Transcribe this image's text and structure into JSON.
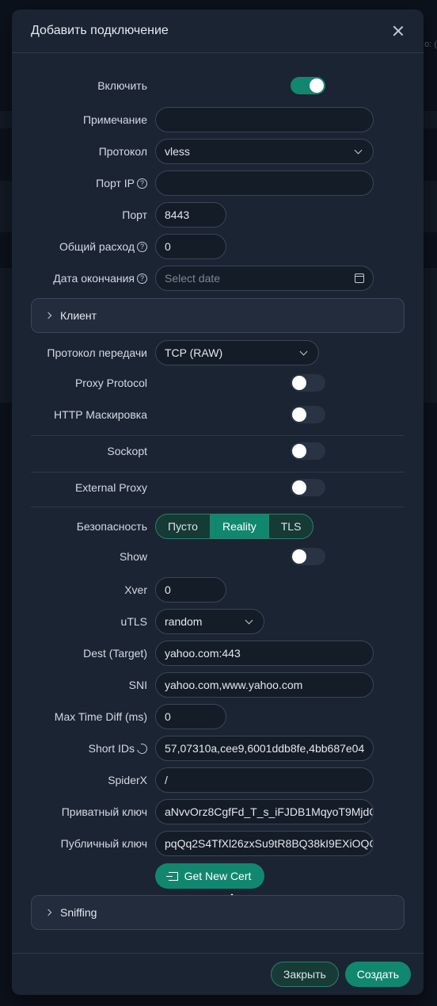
{
  "background": {
    "peek_text": "o: ("
  },
  "modal": {
    "title": "Добавить подключение",
    "fields": {
      "enable": {
        "label": "Включить",
        "on": true
      },
      "remark": {
        "label": "Примечание",
        "value": ""
      },
      "protocol": {
        "label": "Протокол",
        "value": "vless"
      },
      "port_ip": {
        "label": "Порт IP",
        "value": ""
      },
      "port": {
        "label": "Порт",
        "value": "8443"
      },
      "total_traffic": {
        "label": "Общий расход",
        "value": "0"
      },
      "expiry": {
        "label": "Дата окончания",
        "placeholder": "Select date"
      }
    },
    "client_panel": {
      "label": "Клиент"
    },
    "transport": {
      "network": {
        "label": "Протокол передачи",
        "value": "TCP (RAW)"
      },
      "proxy_protocol": {
        "label": "Proxy Protocol",
        "on": false
      },
      "http_mask": {
        "label": "HTTP Маскировка",
        "on": false
      },
      "sockopt": {
        "label": "Sockopt",
        "on": false
      },
      "external_proxy": {
        "label": "External Proxy",
        "on": false
      }
    },
    "security": {
      "label": "Безопасность",
      "options": [
        "Пусто",
        "Reality",
        "TLS"
      ],
      "selected": "Reality",
      "show": {
        "label": "Show",
        "on": false
      },
      "xver": {
        "label": "Xver",
        "value": "0"
      },
      "utls": {
        "label": "uTLS",
        "value": "random"
      },
      "dest": {
        "label": "Dest (Target)",
        "value": "yahoo.com:443"
      },
      "sni": {
        "label": "SNI",
        "value": "yahoo.com,www.yahoo.com"
      },
      "max_time_diff": {
        "label": "Max Time Diff (ms)",
        "value": "0"
      },
      "short_ids": {
        "label": "Short IDs",
        "value": "57,07310a,cee9,6001ddb8fe,4bb687e04"
      },
      "spider_x": {
        "label": "SpiderX",
        "value": "/"
      },
      "private_key": {
        "label": "Приватный ключ",
        "value": "aNvvOrz8CgfFd_T_s_iFJDB1MqyoT9MjdC"
      },
      "public_key": {
        "label": "Публичный ключ",
        "value": "pqQq2S4TfXl26zxSu9tR8BQ38kI9EXiOQC"
      },
      "get_cert_label": "Get New Cert"
    },
    "sniffing_panel": {
      "label": "Sniffing"
    },
    "footer": {
      "close_label": "Закрыть",
      "create_label": "Создать"
    }
  },
  "colors": {
    "accent": "#12876f",
    "modal_bg": "#1b2433",
    "page_bg": "#0c121c"
  }
}
